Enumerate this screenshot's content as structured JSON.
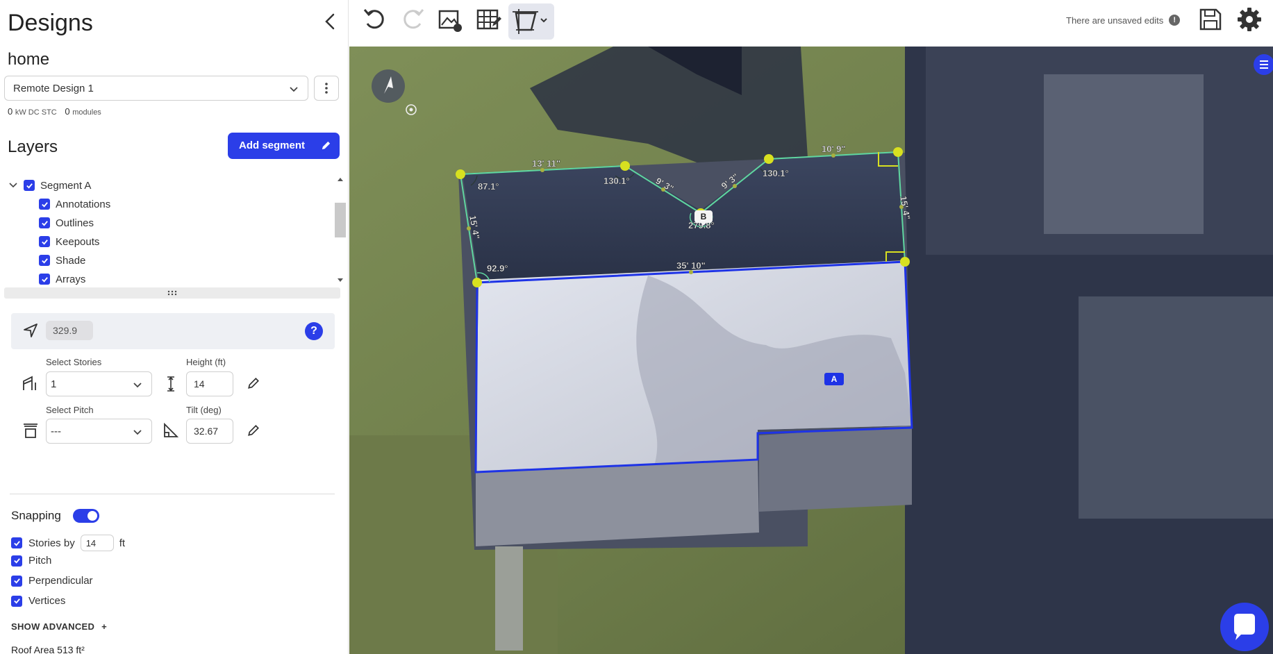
{
  "sidebar": {
    "title": "Designs",
    "project_name": "home",
    "design_select": "Remote Design 1",
    "stats": {
      "kw_value": "0",
      "kw_unit": "kW DC STC",
      "modules_value": "0",
      "modules_unit": "modules"
    },
    "layers_title": "Layers",
    "add_segment_label": "Add segment",
    "layers": {
      "segment": "Segment A",
      "children": [
        "Annotations",
        "Outlines",
        "Keepouts",
        "Shade",
        "Arrays"
      ]
    },
    "azimuth_value": "329.9",
    "help_label": "?",
    "stories": {
      "label": "Select Stories",
      "value": "1"
    },
    "height": {
      "label": "Height (ft)",
      "value": "14"
    },
    "pitch": {
      "label": "Select Pitch",
      "value": "---"
    },
    "tilt": {
      "label": "Tilt (deg)",
      "value": "32.67"
    },
    "snapping": {
      "title": "Snapping",
      "stories_by_label": "Stories by",
      "stories_by_value": "14",
      "stories_by_unit": "ft",
      "pitch_label": "Pitch",
      "perpendicular_label": "Perpendicular",
      "vertices_label": "Vertices"
    },
    "show_advanced": "SHOW ADVANCED",
    "show_advanced_plus": "+",
    "roof_area": "Roof Area 513 ft²"
  },
  "toolbar": {
    "unsaved_text": "There are unsaved edits",
    "warn_glyph": "!"
  },
  "map": {
    "segment_labels": {
      "a": "A",
      "b": "B"
    },
    "measurements": {
      "edge_top_left": "13' 11\"",
      "edge_top_right": "10' 9\"",
      "edge_right": "15' 4\"",
      "edge_left": "15' 4\"",
      "edge_bottom": "35' 10\"",
      "edge_valley_left": "9' 3\"",
      "edge_valley_right": "9' 3\"",
      "angle_tl": "87.1°",
      "angle_peak_left": "130.1°",
      "angle_peak_right": "130.1°",
      "angle_valley": "279.8°",
      "angle_bl": "92.9°"
    }
  },
  "colors": {
    "accent": "#2b3ee8",
    "outline_green": "#5fd6a0",
    "vertex_yellow": "#d8e020",
    "segment_blue": "#1e33e6"
  }
}
